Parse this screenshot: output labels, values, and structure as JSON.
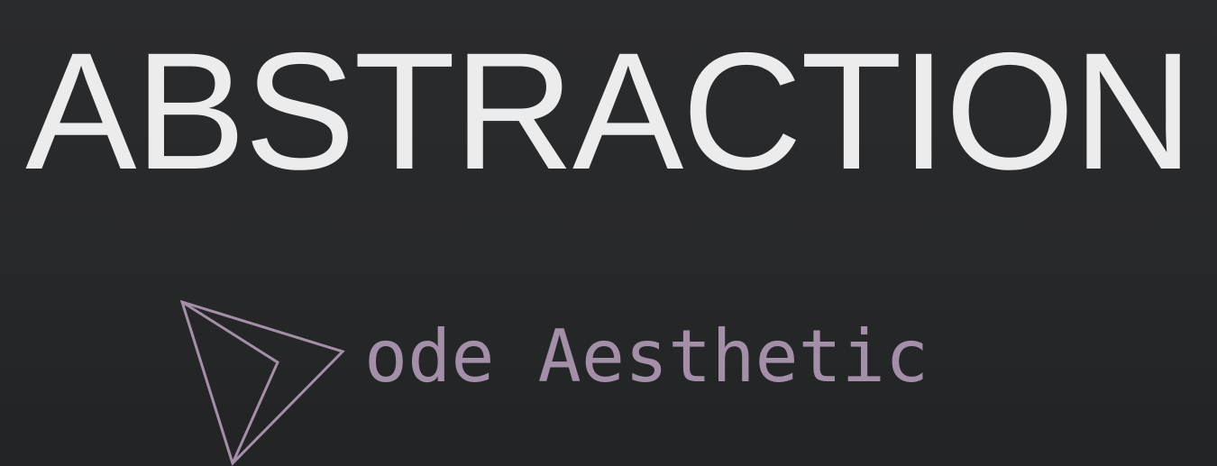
{
  "headline": {
    "text": "ABSTRACTION"
  },
  "brand": {
    "text": "ode Aesthetic",
    "logo_icon": "paper-plane-triangle-icon",
    "accent_color": "#a48fa8"
  },
  "colors": {
    "background": "#28292b",
    "headline": "#ececec"
  }
}
